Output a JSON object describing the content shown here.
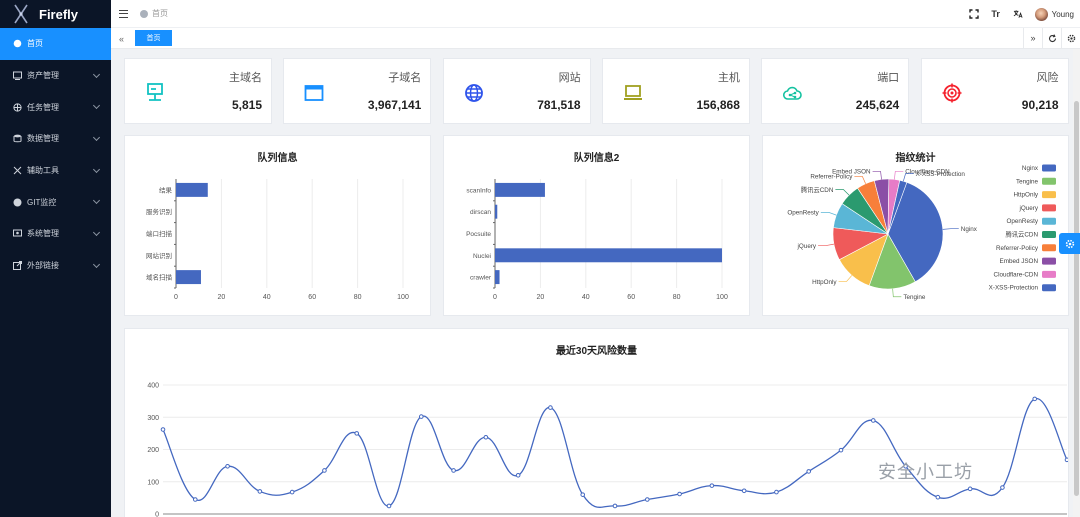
{
  "app": {
    "name": "Firefly"
  },
  "sidebar": {
    "items": [
      {
        "label": "首页",
        "icon": "dashboard-icon",
        "active": true
      },
      {
        "label": "资产管理",
        "icon": "asset-icon"
      },
      {
        "label": "任务管理",
        "icon": "task-icon"
      },
      {
        "label": "数据管理",
        "icon": "database-icon"
      },
      {
        "label": "辅助工具",
        "icon": "tools-icon"
      },
      {
        "label": "GIT监控",
        "icon": "github-icon"
      },
      {
        "label": "系统管理",
        "icon": "system-icon"
      },
      {
        "label": "外部链接",
        "icon": "external-link-icon"
      }
    ]
  },
  "header": {
    "breadcrumb": "首页",
    "user": "Young",
    "font_button": "Tr"
  },
  "tabs": {
    "items": [
      "首页"
    ]
  },
  "stats": [
    {
      "title": "主域名",
      "value": "5,815",
      "icon": "server-icon",
      "color": "#13c2c2"
    },
    {
      "title": "子域名",
      "value": "3,967,141",
      "icon": "browser-window-icon",
      "color": "#1890ff"
    },
    {
      "title": "网站",
      "value": "781,518",
      "icon": "globe-icon",
      "color": "#2f54eb"
    },
    {
      "title": "主机",
      "value": "156,868",
      "icon": "laptop-icon",
      "color": "#a0a020"
    },
    {
      "title": "端口",
      "value": "245,624",
      "icon": "cloud-share-icon",
      "color": "#13c2a0"
    },
    {
      "title": "风险",
      "value": "90,218",
      "icon": "target-icon",
      "color": "#f5222d"
    }
  ],
  "chart_data": [
    {
      "type": "bar",
      "orientation": "horizontal",
      "title": "队列信息",
      "categories": [
        "域名扫描",
        "网站识别",
        "端口扫描",
        "服务识别",
        "结果"
      ],
      "values": [
        11,
        0,
        0,
        0,
        14
      ],
      "xlim": [
        0,
        100
      ],
      "xticks": [
        0,
        20,
        40,
        60,
        80,
        100
      ],
      "color": "#4468c0",
      "grid": true
    },
    {
      "type": "bar",
      "orientation": "horizontal",
      "title": "队列信息2",
      "categories": [
        "crawler",
        "Nuclei",
        "Pocsuite",
        "dirscan",
        "scanInfo"
      ],
      "values": [
        2,
        100,
        0,
        1,
        22
      ],
      "xlim": [
        0,
        100
      ],
      "xticks": [
        0,
        20,
        40,
        60,
        80,
        100
      ],
      "color": "#4468c0",
      "grid": true
    },
    {
      "type": "pie",
      "title": "指纹统计",
      "legend_position": "right",
      "labels": [
        "Nginx",
        "Tengine",
        "HttpOnly",
        "jQuery",
        "OpenResty",
        "腾讯云CDN",
        "Referrer-Policy",
        "Embed JSON",
        "Cloudflare-CDN",
        "X-XSS-Protection"
      ],
      "values": [
        34,
        13,
        11,
        9,
        7,
        6,
        5,
        4,
        3,
        2
      ],
      "colors": [
        "#4468c0",
        "#82c46c",
        "#f9bf4b",
        "#ef5a5a",
        "#5ab6d6",
        "#2b9a6f",
        "#f77f3a",
        "#8b4fa6",
        "#e77cc7",
        "#4468c0"
      ]
    },
    {
      "type": "line",
      "title": "最近30天风险数量",
      "smooth": true,
      "values": [
        262,
        45,
        148,
        70,
        68,
        135,
        250,
        25,
        302,
        135,
        238,
        120,
        330,
        60,
        25,
        45,
        62,
        88,
        72,
        68,
        132,
        198,
        290,
        148,
        52,
        78,
        82,
        357,
        168
      ],
      "ylim": [
        0,
        400
      ],
      "yticks": [
        0,
        100,
        200,
        300,
        400
      ],
      "color": "#4468c0",
      "grid": true
    }
  ],
  "watermark": "安全小工坊"
}
